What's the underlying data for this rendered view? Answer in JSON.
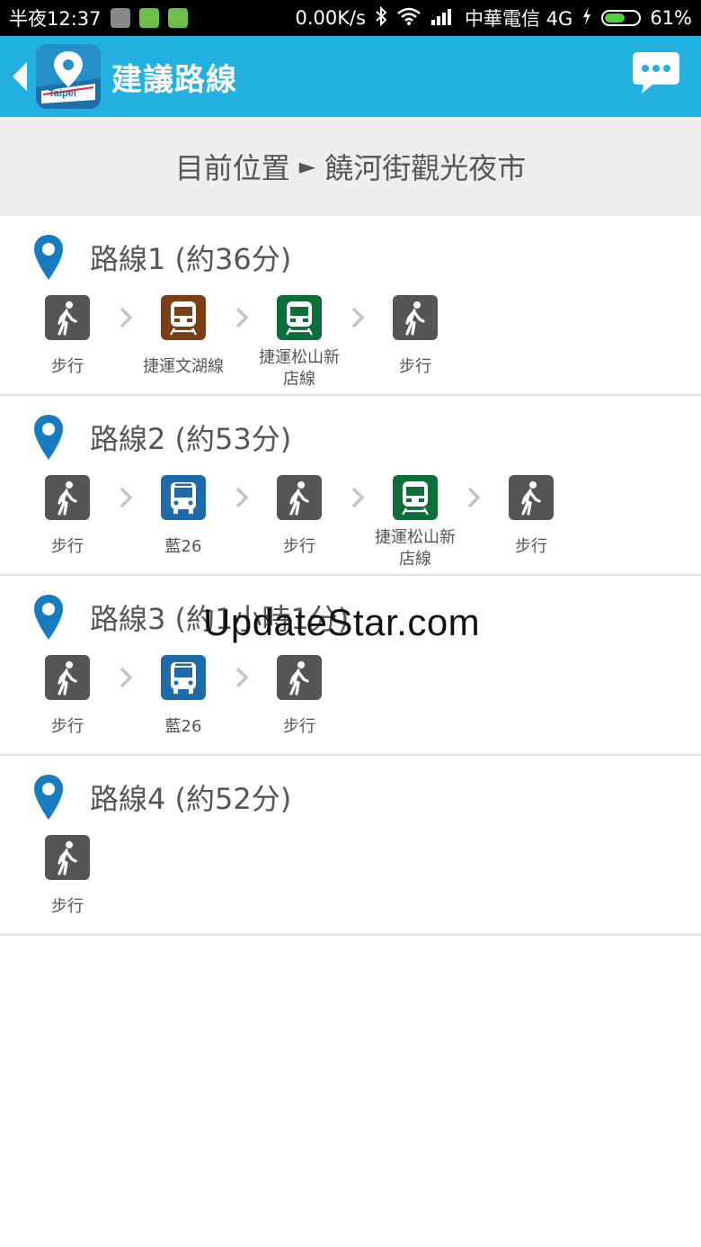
{
  "status_bar": {
    "time": "半夜12:37",
    "speed": "0.00K/s",
    "carrier": "中華電信 4G",
    "battery": "61%",
    "battery_level": 0.61
  },
  "app_bar": {
    "title": "建議路線",
    "logo_text": "Taipei",
    "back_icon": "chevron-left-icon",
    "chat_icon": "chat-bubble-icon",
    "color": "#21b0e0"
  },
  "header": {
    "from": "目前位置",
    "separator": "►",
    "to": "饒河街觀光夜市"
  },
  "routes": [
    {
      "name": "路線1 (約36分)",
      "steps": [
        {
          "type": "walk",
          "label": "步行"
        },
        {
          "type": "metro-brown",
          "label": "捷運文湖線"
        },
        {
          "type": "metro-green",
          "label": "捷運松山新店線"
        },
        {
          "type": "walk",
          "label": "步行"
        }
      ]
    },
    {
      "name": "路線2 (約53分)",
      "steps": [
        {
          "type": "walk",
          "label": "步行"
        },
        {
          "type": "bus",
          "label": "藍26"
        },
        {
          "type": "walk",
          "label": "步行"
        },
        {
          "type": "metro-green",
          "label": "捷運松山新店線"
        },
        {
          "type": "walk",
          "label": "步行"
        }
      ]
    },
    {
      "name": "路線3 (約1小時1分)",
      "steps": [
        {
          "type": "walk",
          "label": "步行"
        },
        {
          "type": "bus",
          "label": "藍26"
        },
        {
          "type": "walk",
          "label": "步行"
        }
      ]
    },
    {
      "name": "路線4 (約52分)",
      "steps": [
        {
          "type": "walk",
          "label": "步行"
        }
      ]
    }
  ],
  "watermark": "UpdateStar.com",
  "colors": {
    "pin": "#1a7cc0",
    "walk": "#555555",
    "metro_brown": "#7a3e17",
    "metro_green": "#0c6f3a",
    "bus": "#1f6aa8"
  }
}
